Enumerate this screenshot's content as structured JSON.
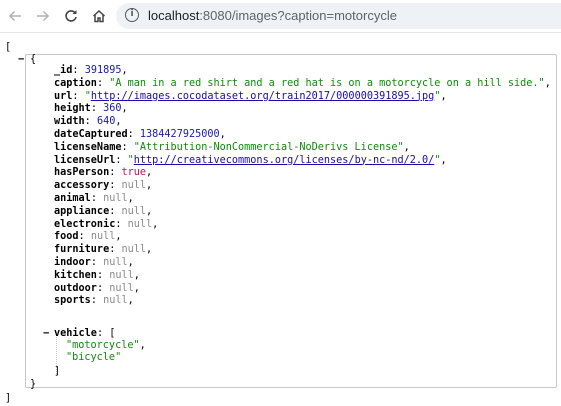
{
  "browser": {
    "back_icon": "arrow-left-icon",
    "forward_icon": "arrow-right-icon",
    "reload_icon": "reload-icon",
    "home_icon": "home-icon",
    "info_icon": "info-icon",
    "url_host": "localhost",
    "url_rest": ":8080/images?caption=motorcycle"
  },
  "json": {
    "open_bracket": "[",
    "close_bracket": "]",
    "obj_open": "{",
    "obj_close": "}",
    "toggle_obj": "−",
    "toggle_vehicle": "−",
    "vehicle_close": "]",
    "fields": [
      {
        "key": "_id",
        "value": "391895",
        "type": "number"
      },
      {
        "key": "caption",
        "value": "\"A man in a red shirt and a red hat is on a motorcycle on a hill side.\"",
        "type": "string"
      },
      {
        "key": "url",
        "value": "http://images.cocodataset.org/train2017/000000391895.jpg",
        "type": "link"
      },
      {
        "key": "height",
        "value": "360",
        "type": "number"
      },
      {
        "key": "width",
        "value": "640",
        "type": "number"
      },
      {
        "key": "dateCaptured",
        "value": "1384427925000",
        "type": "number"
      },
      {
        "key": "licenseName",
        "value": "\"Attribution-NonCommercial-NoDerivs License\"",
        "type": "string"
      },
      {
        "key": "licenseUrl",
        "value": "http://creativecommons.org/licenses/by-nc-nd/2.0/",
        "type": "link"
      },
      {
        "key": "hasPerson",
        "value": "true",
        "type": "bool"
      },
      {
        "key": "accessory",
        "value": "null",
        "type": "null"
      },
      {
        "key": "animal",
        "value": "null",
        "type": "null"
      },
      {
        "key": "appliance",
        "value": "null",
        "type": "null"
      },
      {
        "key": "electronic",
        "value": "null",
        "type": "null"
      },
      {
        "key": "food",
        "value": "null",
        "type": "null"
      },
      {
        "key": "furniture",
        "value": "null",
        "type": "null"
      },
      {
        "key": "indoor",
        "value": "null",
        "type": "null"
      },
      {
        "key": "kitchen",
        "value": "null",
        "type": "null"
      },
      {
        "key": "outdoor",
        "value": "null",
        "type": "null"
      },
      {
        "key": "sports",
        "value": "null",
        "type": "null"
      }
    ],
    "vehicle": {
      "key": "vehicle",
      "open": "[",
      "items": [
        "\"motorcycle\"",
        "\"bicycle\""
      ]
    }
  }
}
